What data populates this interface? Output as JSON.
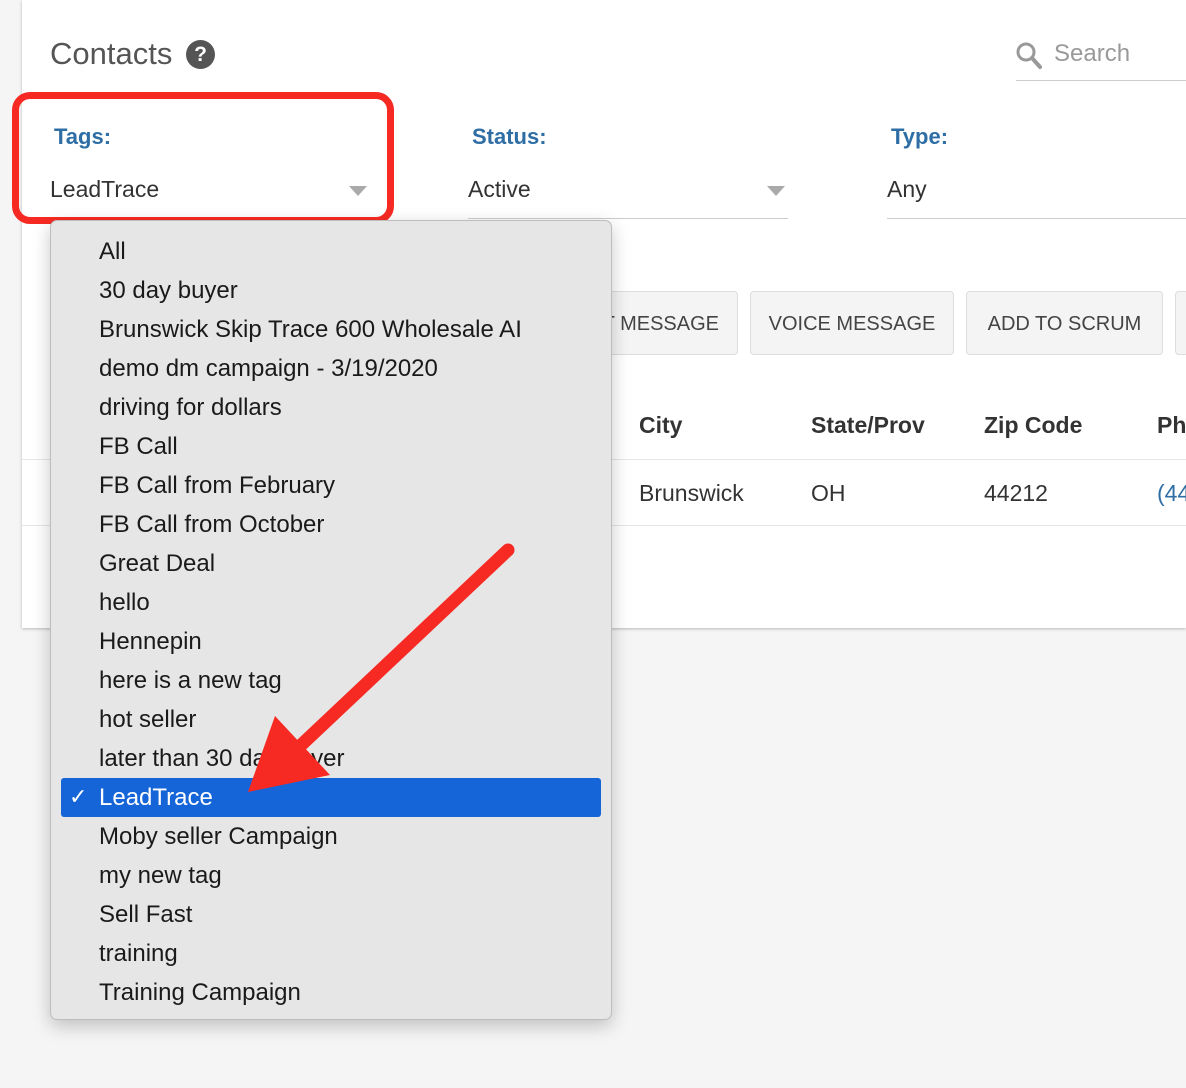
{
  "page": {
    "title": "Contacts",
    "help_icon": "?",
    "search_placeholder": "Search"
  },
  "filters": {
    "tags": {
      "label": "Tags:",
      "value": "LeadTrace"
    },
    "status": {
      "label": "Status:",
      "value": "Active"
    },
    "type": {
      "label": "Type:",
      "value": "Any"
    }
  },
  "actions": {
    "text_message_partial": "T MESSAGE",
    "voice_message": "VOICE MESSAGE",
    "add_to_scrum": "ADD TO SCRUM"
  },
  "table": {
    "headers": {
      "city": "City",
      "state": "State/Prov",
      "zip": "Zip Code",
      "phone_partial": "Ph"
    },
    "row": {
      "city": "Brunswick",
      "state": "OH",
      "zip": "44212",
      "phone_partial": "(44"
    }
  },
  "tags_dropdown": {
    "items": [
      "All",
      "30 day buyer",
      "Brunswick Skip Trace 600 Wholesale AI",
      "demo dm campaign - 3/19/2020",
      "driving for dollars",
      "FB Call",
      "FB Call from February",
      "FB Call from October",
      "Great Deal",
      "hello",
      "Hennepin",
      "here is a new tag",
      "hot seller",
      "later than 30 day buyer",
      "LeadTrace",
      "Moby seller Campaign",
      "my new tag",
      "Sell Fast",
      "training",
      "Training Campaign"
    ],
    "selected": "LeadTrace",
    "check_mark": "✓"
  },
  "colors": {
    "accent": "#2f6ea5",
    "selection": "#1565d8",
    "annotation": "#f72a23"
  }
}
